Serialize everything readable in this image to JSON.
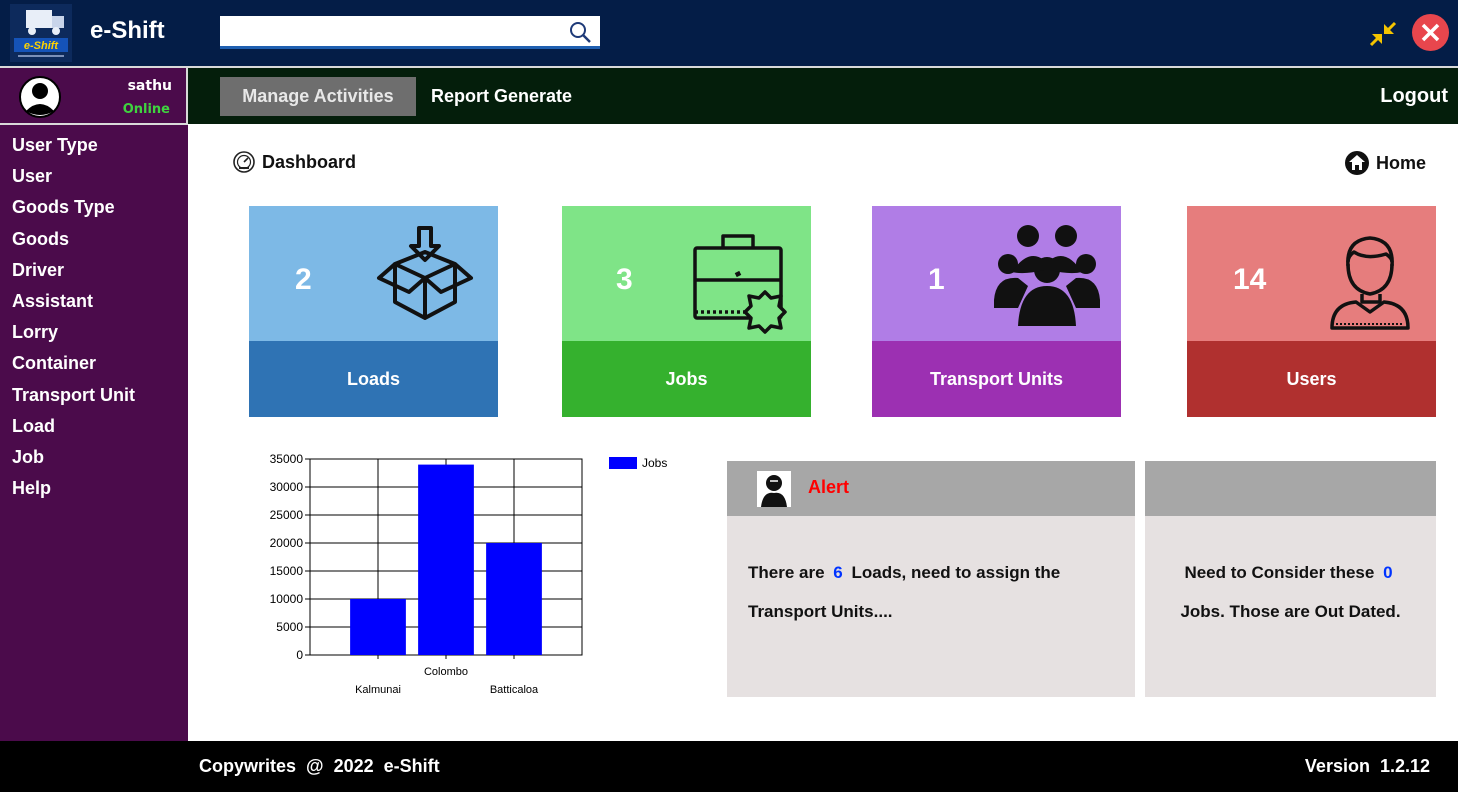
{
  "app": {
    "logo_text": "e-Shift",
    "logo_badge": "e-Shift"
  },
  "search": {
    "placeholder": ""
  },
  "user": {
    "name": "sathu",
    "status": "Online"
  },
  "nav": {
    "manage": "Manage Activities",
    "report": "Report Generate",
    "logout": "Logout"
  },
  "sidebar": {
    "items": [
      {
        "label": "User Type"
      },
      {
        "label": "User"
      },
      {
        "label": "Goods Type"
      },
      {
        "label": "Goods"
      },
      {
        "label": "Driver"
      },
      {
        "label": "Assistant"
      },
      {
        "label": "Lorry"
      },
      {
        "label": "Container"
      },
      {
        "label": "Transport Unit"
      },
      {
        "label": "Load"
      },
      {
        "label": "Job"
      },
      {
        "label": "Help"
      }
    ]
  },
  "dashboard": {
    "title": "Dashboard",
    "home": "Home"
  },
  "cards": [
    {
      "count": "2",
      "label": "Loads",
      "icon": "box-icon",
      "top_color": "#7db9e6",
      "bottom_color": "#2f73b4"
    },
    {
      "count": "3",
      "label": "Jobs",
      "icon": "briefcase-icon",
      "top_color": "#7fe487",
      "bottom_color": "#35b12e"
    },
    {
      "count": "1",
      "label": "Transport Units",
      "icon": "group-icon",
      "top_color": "#b07de6",
      "bottom_color": "#9c30b2"
    },
    {
      "count": "14",
      "label": "Users",
      "icon": "user-icon",
      "top_color": "#e67d7d",
      "bottom_color": "#b0302f"
    }
  ],
  "chart_data": {
    "type": "bar",
    "categories": [
      "Kalmunai",
      "Colombo",
      "Batticaloa"
    ],
    "series": [
      {
        "name": "Jobs",
        "values": [
          10000,
          34000,
          20000
        ],
        "color": "#0000ff"
      }
    ],
    "ylim": [
      0,
      35000
    ],
    "yticks": [
      0,
      5000,
      10000,
      15000,
      20000,
      25000,
      30000,
      35000
    ],
    "grid": true,
    "legend": "top-right"
  },
  "alert": {
    "title": "Alert",
    "text_before": "There are",
    "loads_count": "6",
    "text_after": "Loads, need to assign the Transport Units...."
  },
  "outdated": {
    "text_before": "Need to Consider these",
    "jobs_count": "0",
    "text_after": "Jobs. Those are Out Dated."
  },
  "footer": {
    "copyright": "Copywrites  @  2022  e-Shift",
    "version": "Version  1.2.12"
  }
}
